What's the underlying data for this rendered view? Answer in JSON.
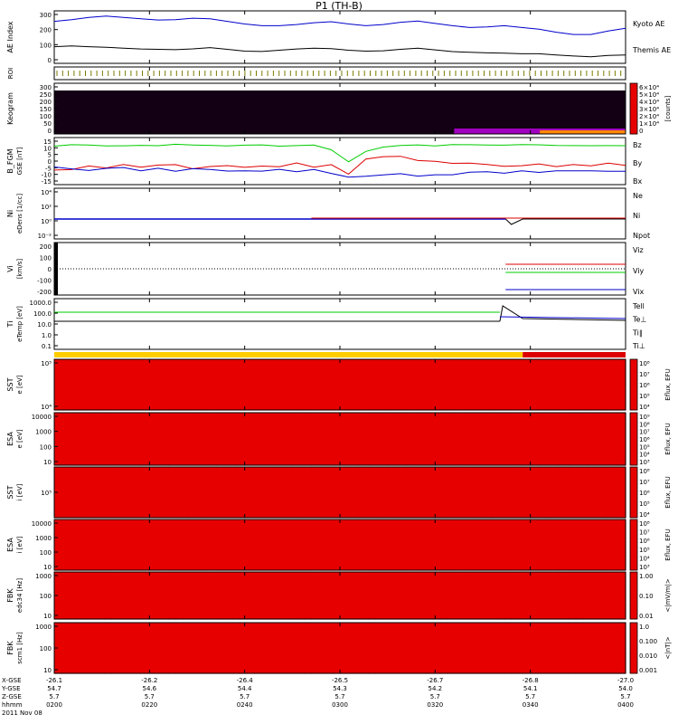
{
  "chart_data": {
    "type": "line",
    "title": "P1 (TH-B)",
    "panels": [
      {
        "id": "ae",
        "ylabel": "AE Index",
        "yticks": [
          "300",
          "200",
          "100",
          "0"
        ],
        "series": [
          {
            "name": "Kyoto AE",
            "color": "#0000cc"
          },
          {
            "name": "Themis AE",
            "color": "#000000"
          }
        ],
        "ylim": [
          0,
          300
        ],
        "kyoto": [
          240,
          250,
          262,
          270,
          262,
          255,
          248,
          250,
          258,
          255,
          240,
          225,
          215,
          215,
          222,
          232,
          238,
          225,
          215,
          222,
          235,
          242,
          228,
          215,
          205,
          208,
          215,
          205,
          195,
          178,
          165,
          165,
          185,
          200
        ],
        "themis": [
          95,
          100,
          95,
          92,
          87,
          82,
          80,
          78,
          83,
          90,
          80,
          70,
          68,
          75,
          82,
          87,
          84,
          75,
          70,
          72,
          80,
          87,
          77,
          67,
          63,
          60,
          58,
          55,
          55,
          48,
          42,
          38,
          45,
          48
        ]
      },
      {
        "id": "roi",
        "ylabel": "ROI"
      },
      {
        "id": "keo",
        "ylabel": "Keogram",
        "yticks": [
          "300",
          "250",
          "200",
          "150",
          "100",
          "50",
          "0"
        ],
        "cbar_ticks": [
          "6×10⁴",
          "5×10⁴",
          "4×10⁴",
          "3×10⁴",
          "2×10⁴",
          "1×10⁴",
          "0"
        ],
        "cbar_label": "[counts]"
      },
      {
        "id": "bfgm",
        "ylabel": "B_FGM",
        "sublabel": "GSE [nT]",
        "yticks": [
          "15",
          "10",
          "5",
          "0",
          "-5",
          "-10",
          "-15"
        ],
        "ylim": [
          -15,
          15
        ],
        "series": [
          {
            "name": "Bz",
            "color": "#dd0000"
          },
          {
            "name": "By",
            "color": "#00cc00"
          },
          {
            "name": "Bx",
            "color": "#0000cc"
          }
        ],
        "by": [
          10,
          10,
          10.5,
          10,
          9.5,
          10,
          10,
          10.5,
          10,
          10,
          9.5,
          10,
          10,
          9.8,
          10,
          10,
          7,
          0,
          6,
          9,
          9.5,
          10,
          10,
          10.5,
          10,
          10,
          10,
          10.5,
          10,
          9.5,
          10,
          10,
          9.5,
          10
        ],
        "bz": [
          -5,
          -5,
          -3,
          -4,
          -3,
          -4,
          -3,
          -3,
          -4,
          -3,
          -3,
          -4,
          -3,
          -3,
          -2,
          -3,
          -2,
          -8,
          1,
          2,
          3,
          1,
          0,
          -1,
          -1,
          -2,
          -3,
          -3,
          -2,
          -3,
          -3,
          -3,
          -2,
          -3
        ],
        "bx": [
          -4,
          -5,
          -6,
          -5,
          -5,
          -6,
          -5,
          -6,
          -5,
          -5,
          -6,
          -6,
          -7,
          -6,
          -6,
          -6,
          -7,
          -10,
          -9,
          -8,
          -9,
          -9,
          -9,
          -8,
          -7,
          -7,
          -7,
          -7,
          -8,
          -7,
          -7,
          -7,
          -7,
          -6
        ]
      },
      {
        "id": "ni",
        "ylabel": "Ni",
        "sublabel": "eDens [1/cc]",
        "yticks": [
          "10⁴",
          "10²",
          "10⁰",
          "10⁻²"
        ],
        "series": [
          {
            "name": "Ne",
            "color": "#dd0000"
          },
          {
            "name": "Ni",
            "color": "#000000"
          },
          {
            "name": "Npot",
            "color": "#0000cc"
          }
        ]
      },
      {
        "id": "vi",
        "ylabel": "Vi",
        "sublabel": "[km/s]",
        "yticks": [
          "200",
          "100",
          "0",
          "-100",
          "-200"
        ],
        "ylim": [
          -300,
          300
        ],
        "series": [
          {
            "name": "Viz",
            "color": "#dd0000"
          },
          {
            "name": "Viy",
            "color": "#00cc00"
          },
          {
            "name": "Vix",
            "color": "#0000cc"
          }
        ]
      },
      {
        "id": "ti",
        "ylabel": "Ti",
        "sublabel": "eTemp [eV]",
        "yticks": [
          "1000.0",
          "100.0",
          "10.0",
          "1.0",
          "0.1"
        ],
        "series": [
          {
            "name": "Tell",
            "color": "#000000"
          },
          {
            "name": "Te⊥",
            "color": "#dd0000"
          },
          {
            "name": "Ti∥",
            "color": "#00cc00"
          },
          {
            "name": "Ti⊥",
            "color": "#0000cc"
          }
        ]
      },
      {
        "id": "mode"
      },
      {
        "id": "sst_e",
        "ylabel": "SST",
        "sublabel": "e [eV]",
        "yticks": [
          "10⁵",
          "10⁴"
        ],
        "cbar_ticks": [
          "10⁸",
          "10⁷",
          "10⁶",
          "10⁵",
          "10⁴"
        ],
        "cbar_label": "Eflux, EFU"
      },
      {
        "id": "esa_e",
        "ylabel": "ESA",
        "sublabel": "e [eV]",
        "yticks": [
          "10000",
          "1000",
          "100",
          "10"
        ],
        "cbar_ticks": [
          "10⁹",
          "10⁸",
          "10⁷",
          "10⁶",
          "10⁵",
          "10⁴",
          "10³"
        ],
        "cbar_label": "Eflux, EFU"
      },
      {
        "id": "sst_i",
        "ylabel": "SST",
        "sublabel": "i [eV]",
        "yticks": [
          "10⁵"
        ],
        "cbar_ticks": [
          "10⁸",
          "10⁷",
          "10⁶",
          "10⁵",
          "10⁴"
        ],
        "cbar_label": "Eflux, EFU"
      },
      {
        "id": "esa_i",
        "ylabel": "ESA",
        "sublabel": "i [eV]",
        "yticks": [
          "10000",
          "1000",
          "100",
          "10"
        ],
        "cbar_ticks": [
          "10⁸",
          "10⁷",
          "10⁶",
          "10⁵",
          "10⁴",
          "10³"
        ],
        "cbar_label": "Eflux, EFU"
      },
      {
        "id": "fbk1",
        "ylabel": "FBK",
        "sublabel": "edc34 [Hz]",
        "yticks": [
          "1000",
          "100",
          "10"
        ],
        "cbar_ticks": [
          "1.00",
          "0.10",
          "0.01"
        ],
        "cbar_label": "<|mV/m|>"
      },
      {
        "id": "fbk2",
        "ylabel": "FBK",
        "sublabel": "scm1 [Hz]",
        "yticks": [
          "1000",
          "100",
          "10"
        ],
        "cbar_ticks": [
          "1.0",
          "0.100",
          "0.010",
          "0.001"
        ],
        "cbar_label": "<|nT|>"
      }
    ],
    "x_axis": {
      "row_labels": [
        "X-GSE",
        "Y-GSE",
        "Z-GSE",
        "hhmm",
        "2011 Nov 08"
      ],
      "ticks": [
        {
          "xgse": "-26.1",
          "ygse": "54.7",
          "zgse": "5.7",
          "hhmm": "0200"
        },
        {
          "xgse": "-26.2",
          "ygse": "54.6",
          "zgse": "5.7",
          "hhmm": "0220"
        },
        {
          "xgse": "-26.4",
          "ygse": "54.4",
          "zgse": "5.7",
          "hhmm": "0240"
        },
        {
          "xgse": "-26.5",
          "ygse": "54.3",
          "zgse": "5.7",
          "hhmm": "0300"
        },
        {
          "xgse": "-26.7",
          "ygse": "54.2",
          "zgse": "5.7",
          "hhmm": "0320"
        },
        {
          "xgse": "-26.8",
          "ygse": "54.1",
          "zgse": "5.7",
          "hhmm": "0340"
        },
        {
          "xgse": "-27.0",
          "ygse": "54.0",
          "zgse": "5.7",
          "hhmm": "0400"
        }
      ]
    }
  }
}
